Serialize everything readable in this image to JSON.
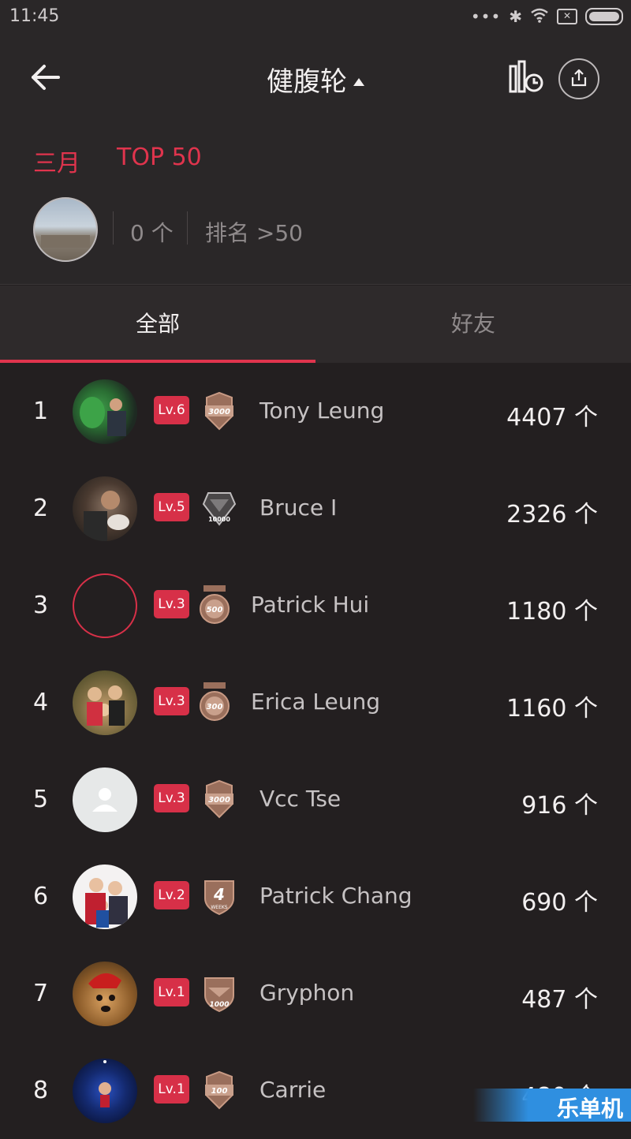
{
  "status_bar": {
    "time": "11:45",
    "icons": [
      "more-dots-icon",
      "bluetooth-icon",
      "wifi-icon",
      "sim-off-icon",
      "battery-icon"
    ]
  },
  "header": {
    "title": "健腹轮",
    "icons": [
      "back-arrow-icon",
      "stats-history-icon",
      "share-icon"
    ]
  },
  "summary": {
    "month": "三月",
    "top": "TOP 50",
    "my_count": "0 个",
    "my_rank": "排名 >50"
  },
  "tabs": [
    {
      "label": "全部",
      "active": true
    },
    {
      "label": "好友",
      "active": false
    }
  ],
  "leaderboard": [
    {
      "rank": "1",
      "level": "Lv.6",
      "medal": "3000",
      "name": "Tony Leung",
      "count": "4407 个"
    },
    {
      "rank": "2",
      "level": "Lv.5",
      "medal": "10000",
      "name": "Bruce I",
      "count": "2326 个"
    },
    {
      "rank": "3",
      "level": "Lv.3",
      "medal": "500",
      "name": "Patrick Hui",
      "count": "1180 个"
    },
    {
      "rank": "4",
      "level": "Lv.3",
      "medal": "300",
      "name": "Erica Leung",
      "count": "1160 个"
    },
    {
      "rank": "5",
      "level": "Lv.3",
      "medal": "3000",
      "name": "Vcc Tse",
      "count": "916 个"
    },
    {
      "rank": "6",
      "level": "Lv.2",
      "medal": "4 WEEKS",
      "name": "Patrick Chang",
      "count": "690 个"
    },
    {
      "rank": "7",
      "level": "Lv.1",
      "medal": "1000",
      "name": "Gryphon",
      "count": "487 个"
    },
    {
      "rank": "8",
      "level": "Lv.1",
      "medal": "100",
      "name": "Carrie",
      "count": "480 个"
    }
  ],
  "colors": {
    "accent": "#e0344d",
    "background": "#231f20",
    "medal": "#9a6f5c"
  },
  "watermark": "乐单机"
}
